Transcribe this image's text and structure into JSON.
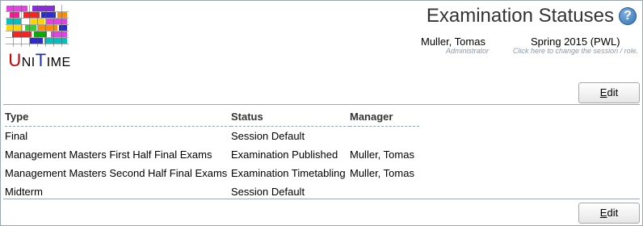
{
  "logo": {
    "text_parts": [
      "U",
      "NI",
      "T",
      "IME"
    ],
    "colors": [
      "#e542e5",
      "#2a2ad8",
      "#ffd400",
      "#00c0c0",
      "#ff2020",
      "#00b000",
      "#ff8c00",
      "#8a2be2",
      "#32cd32",
      "#ff1493"
    ]
  },
  "header": {
    "title": "Examination Statuses",
    "help_glyph": "?",
    "user_name": "Muller, Tomas",
    "user_role": "Administrator",
    "session": "Spring 2015 (PWL)",
    "session_hint": "Click here to change the session / role."
  },
  "buttons": {
    "edit_top": "Edit",
    "edit_bottom": "Edit"
  },
  "table": {
    "headers": [
      "Type",
      "Status",
      "Manager"
    ],
    "rows": [
      {
        "type": "Final",
        "status": "Session Default",
        "manager": ""
      },
      {
        "type": "Management Masters First Half Final Exams",
        "status": "Examination Published",
        "manager": "Muller, Tomas"
      },
      {
        "type": "Management Masters Second Half Final Exams",
        "status": "Examination Timetabling",
        "manager": "Muller, Tomas"
      },
      {
        "type": "Midterm",
        "status": "Session Default",
        "manager": ""
      }
    ]
  }
}
